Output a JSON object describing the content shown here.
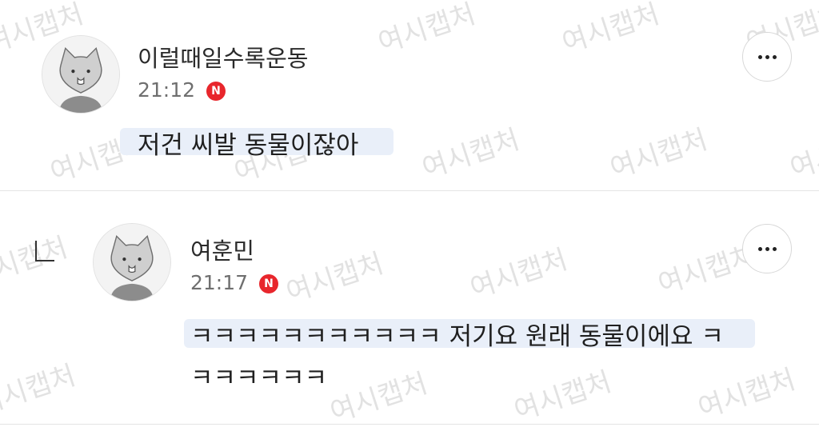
{
  "watermark": "여시캡처",
  "comments": [
    {
      "author": "이럴때일수록운동",
      "time": "21:12",
      "badge": "N",
      "text": "저건 씨발 동물이잖아"
    },
    {
      "author": "여훈민",
      "time": "21:17",
      "badge": "N",
      "text_line1": "ㅋㅋㅋㅋㅋㅋㅋㅋㅋㅋㅋ 저기요 원래 동물이에요 ㅋ",
      "text_line2": "ㅋㅋㅋㅋㅋㅋ"
    }
  ],
  "colors": {
    "badge": "#e8262c",
    "highlight": "#e9eff9",
    "watermark": "#e2e2e2"
  },
  "icons": {
    "more": "more-horizontal-icon",
    "reply": "reply-indent-icon",
    "avatar": "cat-avatar-icon"
  }
}
